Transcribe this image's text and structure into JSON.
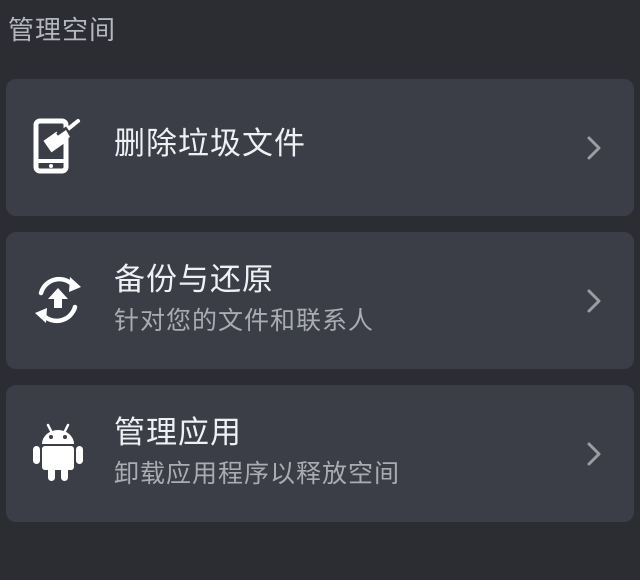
{
  "section": {
    "title": "管理空间"
  },
  "items": [
    {
      "title": "删除垃圾文件",
      "icon": "phone-clean-icon"
    },
    {
      "title": "备份与还原",
      "subtitle": "针对您的文件和联系人",
      "icon": "backup-restore-icon"
    },
    {
      "title": "管理应用",
      "subtitle": "卸载应用程序以释放空间",
      "icon": "android-icon"
    }
  ],
  "colors": {
    "background": "#2b2d33",
    "card": "#3b3e46",
    "title_text": "#eef0f3",
    "subtitle_text": "#a9acb3",
    "section_text": "#b4b7bd",
    "chevron": "#9a9da4"
  }
}
